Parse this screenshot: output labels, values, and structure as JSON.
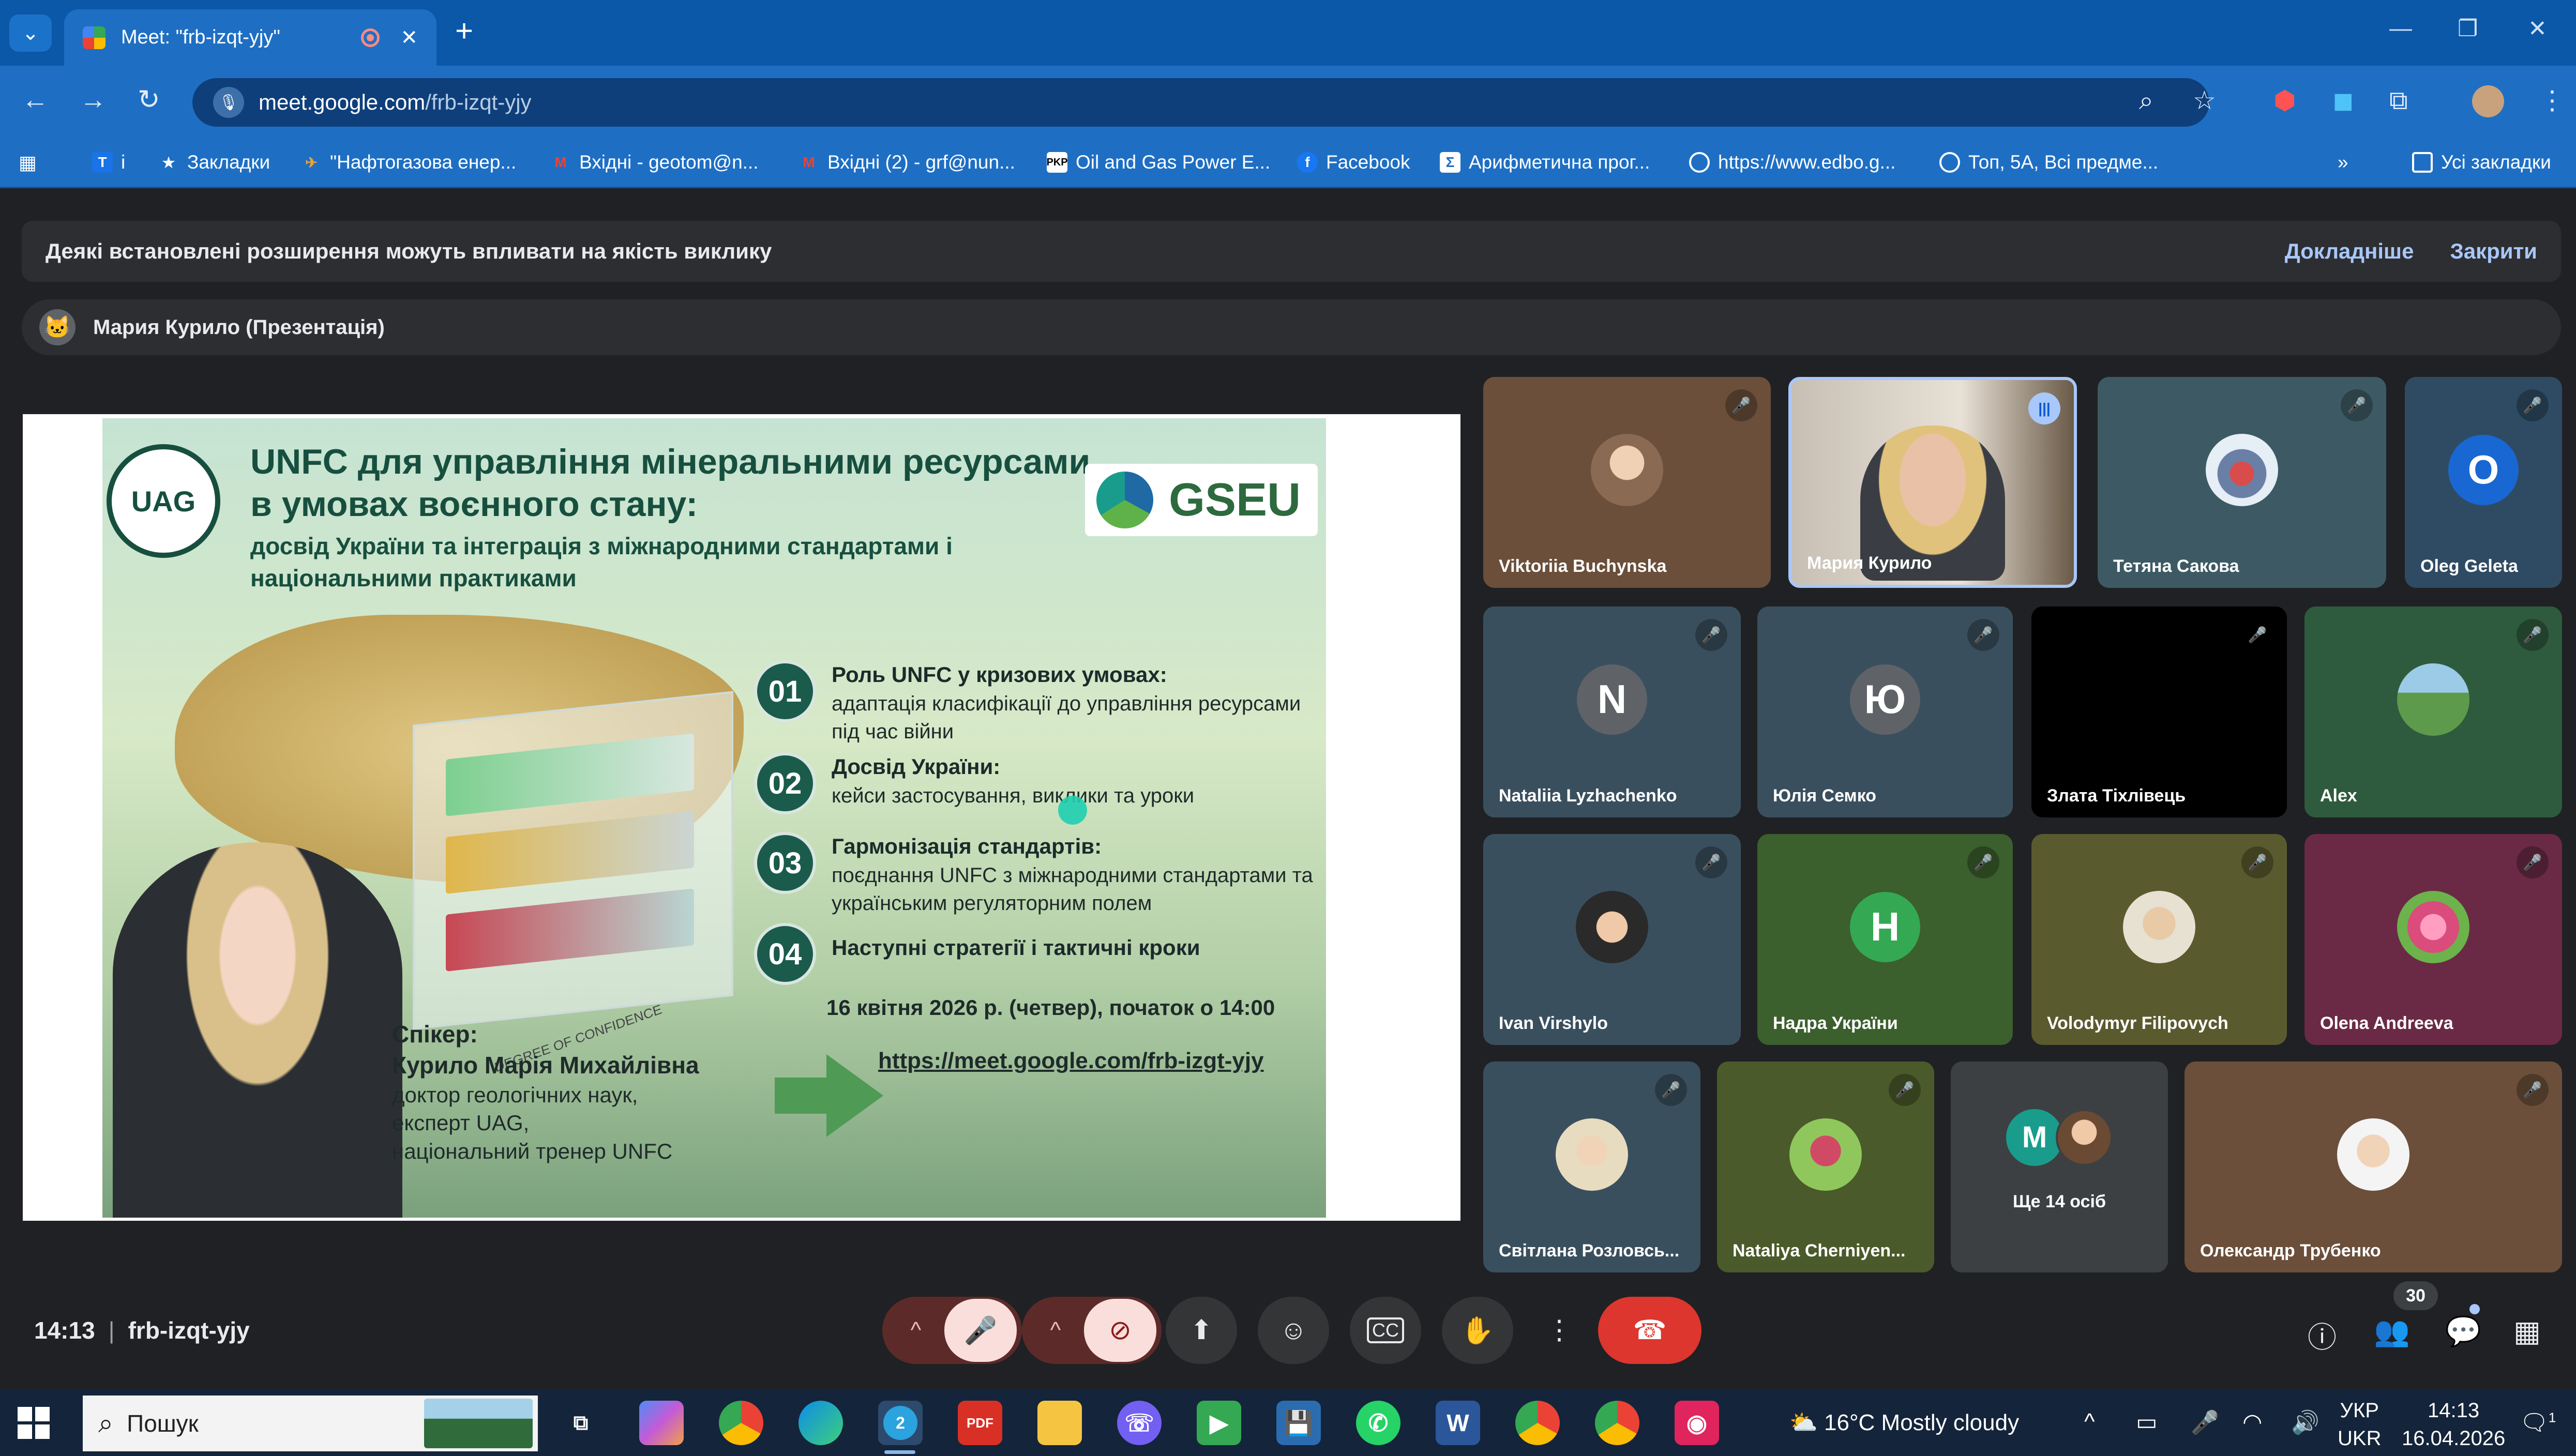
{
  "browser": {
    "tab_title": "Meet: \"frb-izqt-yjy\"",
    "url_host": "meet.google.com",
    "url_path": "/frb-izqt-yjy",
    "bookmarks": [
      {
        "label": "і",
        "icon": "google-translate-icon",
        "color": "#1a73e8"
      },
      {
        "label": "Закладки",
        "icon": "star-icon",
        "color": "#ffffff"
      },
      {
        "label": "\"Нафтогазова енер...",
        "icon": "bird-icon",
        "color": "#e8a33d"
      },
      {
        "label": "Вхідні - geotom@n...",
        "icon": "gmail-icon",
        "color": "#ea4335"
      },
      {
        "label": "Вхідні (2) - grf@nun...",
        "icon": "gmail-icon",
        "color": "#ea4335"
      },
      {
        "label": "Oil and Gas Power E...",
        "icon": "pkp-icon",
        "color": "#ffffff"
      },
      {
        "label": "Facebook",
        "icon": "facebook-icon",
        "color": "#1877f2"
      },
      {
        "label": "Арифметична прог...",
        "icon": "calc-icon",
        "color": "#ffffff"
      },
      {
        "label": "https://www.edbo.g...",
        "icon": "globe-icon",
        "color": "#ffffff"
      },
      {
        "label": "Топ, 5А, Всі предме...",
        "icon": "globe-icon",
        "color": "#ffffff"
      }
    ],
    "all_bookmarks_label": "Усі закладки"
  },
  "notice": {
    "message": "Деякі встановлені розширення можуть впливати на якість виклику",
    "learn_more": "Докладніше",
    "close": "Закрити"
  },
  "presenter": {
    "label": "Мария Курило (Презентація)"
  },
  "slide": {
    "logo_text": "UAG",
    "title": "UNFC для управління мінеральними ресурсами в умовах воєнного стану:",
    "subtitle": "досвід України та інтеграція з міжнародними стандартами і національними практиками",
    "gseu": "GSEU",
    "cube_axis_label": "DEGREE OF CONFIDENCE",
    "items": [
      {
        "num": "01",
        "head": "Роль UNFC у кризових умовах:",
        "body": "адаптація класифікації до управління ресурсами під час війни"
      },
      {
        "num": "02",
        "head": "Досвід України:",
        "body": "кейси застосування, виклики та уроки"
      },
      {
        "num": "03",
        "head": "Гармонізація стандартів:",
        "body": "поєднання UNFC з міжнародними стандартами та українським регуляторним полем"
      },
      {
        "num": "04",
        "head": "Наступні стратегії і тактичні кроки",
        "body": ""
      }
    ],
    "date": "16 квітня 2026 р. (четвер), початок о 14:00",
    "link": "https://meet.google.com/frb-izgt-yjy",
    "speaker_label": "Спікер:",
    "speaker_name": "Курило Марія Михайлівна",
    "speaker_lines": [
      "доктор геологічних наук,",
      "експерт UAG,",
      "національний тренер UNFC"
    ]
  },
  "participants": [
    {
      "name": "Viktoriia Buchynska",
      "bg": "#6b4f3a",
      "type": "photo",
      "muted": true
    },
    {
      "name": "Мария Курило",
      "bg": "#4a4d50",
      "type": "video",
      "speaking": true
    },
    {
      "name": "Тетяна Сакова",
      "bg": "#3d5a64",
      "type": "photo",
      "muted": true
    },
    {
      "name": "Oleg Geleta",
      "bg": "#2f4b63",
      "type": "letter",
      "letter": "O",
      "avcolor": "#1967d2",
      "muted": true
    },
    {
      "name": "Nataliia Lyzhachenko",
      "bg": "#3a4f5e",
      "type": "letter",
      "letter": "N",
      "avcolor": "#5f6368",
      "muted": true
    },
    {
      "name": "Юлія Семко",
      "bg": "#3a4f5e",
      "type": "letter",
      "letter": "Ю",
      "avcolor": "#5f6368",
      "muted": true
    },
    {
      "name": "Злата Тіхлівець",
      "bg": "#000000",
      "type": "none",
      "muted": true
    },
    {
      "name": "Alex",
      "bg": "#2e5b3d",
      "type": "photo",
      "muted": true
    },
    {
      "name": "Ivan Virshylo",
      "bg": "#3a4f5e",
      "type": "photo",
      "muted": true
    },
    {
      "name": "Надра України",
      "bg": "#3b5f2d",
      "type": "letter",
      "letter": "H",
      "avcolor": "#34a853",
      "muted": true
    },
    {
      "name": "Volodymyr Filipovych",
      "bg": "#5a5a2f",
      "type": "photo",
      "muted": true
    },
    {
      "name": "Olena Andreeva",
      "bg": "#6a2a45",
      "type": "photo",
      "muted": true
    },
    {
      "name": "Світлана Розловсь...",
      "bg": "#3a4f5e",
      "type": "photo",
      "muted": true
    },
    {
      "name": "Nataliya Chernіyen...",
      "bg": "#4a5a2a",
      "type": "photo",
      "muted": true
    },
    {
      "name": "Олександр Трубенко",
      "bg": "#6b4f3a",
      "type": "photo",
      "muted": true
    }
  ],
  "more_people": {
    "letter": "M",
    "label": "Ще 14 осіб"
  },
  "call": {
    "time": "14:13",
    "code": "frb-izqt-yjy",
    "participants_count": "30"
  },
  "taskbar": {
    "search_placeholder": "Пошук",
    "weather": "16°C  Mostly cloudy",
    "lang_top": "УКР",
    "lang_bottom": "UKR",
    "time": "14:13",
    "date": "16.04.2026",
    "telegram_badge": "2",
    "notification_count": "1"
  }
}
